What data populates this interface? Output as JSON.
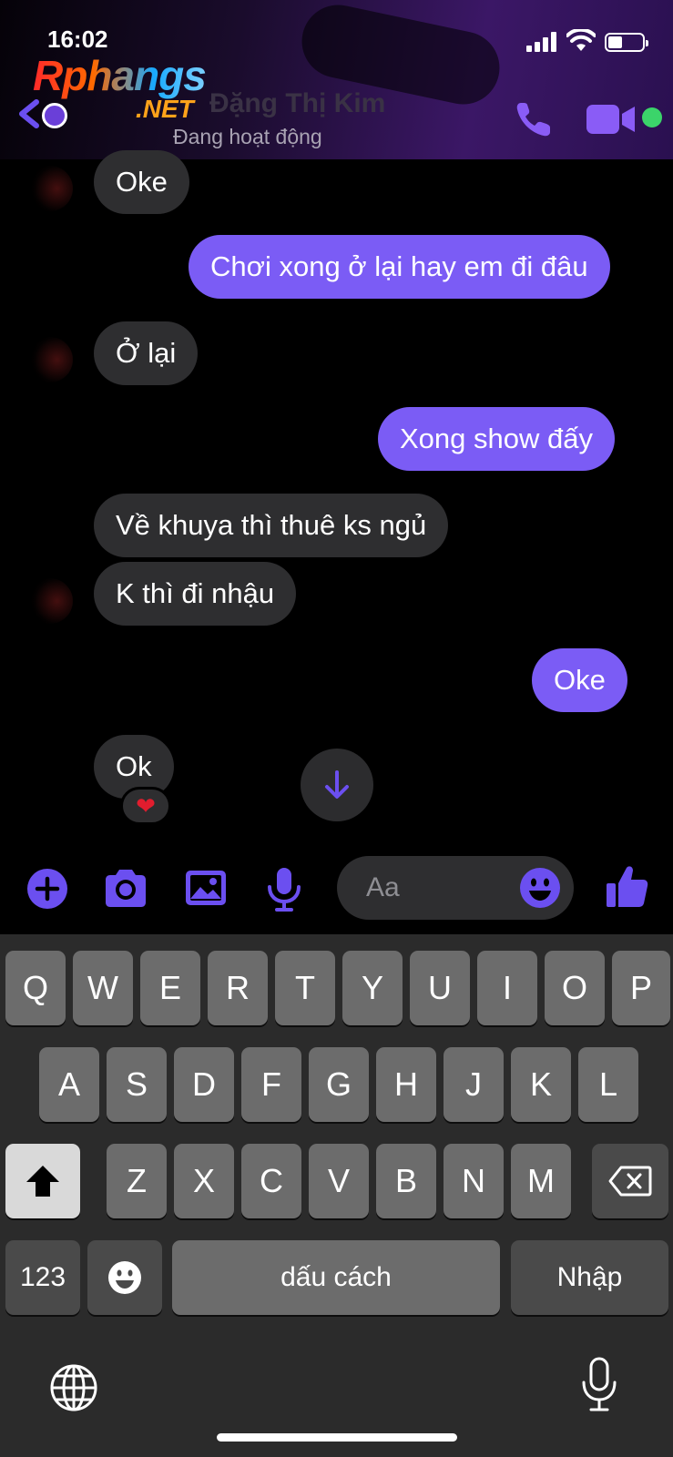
{
  "status_bar": {
    "time": "16:02"
  },
  "watermark": {
    "main": "Rphangs",
    "sub": ".NET"
  },
  "header": {
    "contact_name": "Đặng Thị Kim",
    "status": "Đang hoạt động"
  },
  "messages": [
    {
      "side": "in",
      "text": "Oke"
    },
    {
      "side": "out",
      "text": "Chơi xong ở lại hay em đi đâu"
    },
    {
      "side": "in",
      "text": "Ở lại"
    },
    {
      "side": "out",
      "text": "Xong show đấy"
    },
    {
      "side": "in",
      "text": "Về khuya thì thuê ks ngủ"
    },
    {
      "side": "in",
      "text": "K thì đi nhậu"
    },
    {
      "side": "out",
      "text": "Oke"
    },
    {
      "side": "in",
      "text": "Ok",
      "reaction": "❤"
    }
  ],
  "composer": {
    "placeholder": "Aa"
  },
  "keyboard": {
    "row1": [
      "Q",
      "W",
      "E",
      "R",
      "T",
      "Y",
      "U",
      "I",
      "O",
      "P"
    ],
    "row2": [
      "A",
      "S",
      "D",
      "F",
      "G",
      "H",
      "J",
      "K",
      "L"
    ],
    "row3": [
      "Z",
      "X",
      "C",
      "V",
      "B",
      "N",
      "M"
    ],
    "numbers_key": "123",
    "space_key": "dấu cách",
    "return_key": "Nhập"
  },
  "colors": {
    "accent": "#7b5cf5",
    "icon": "#6b4ff0",
    "online": "#3bd46a"
  },
  "icons": [
    "back-arrow-icon",
    "phone-icon",
    "video-camera-icon",
    "plus-icon",
    "camera-icon",
    "image-icon",
    "microphone-icon",
    "smiley-icon",
    "thumbs-up-icon",
    "shift-icon",
    "delete-icon",
    "globe-icon",
    "arrow-down-icon"
  ]
}
